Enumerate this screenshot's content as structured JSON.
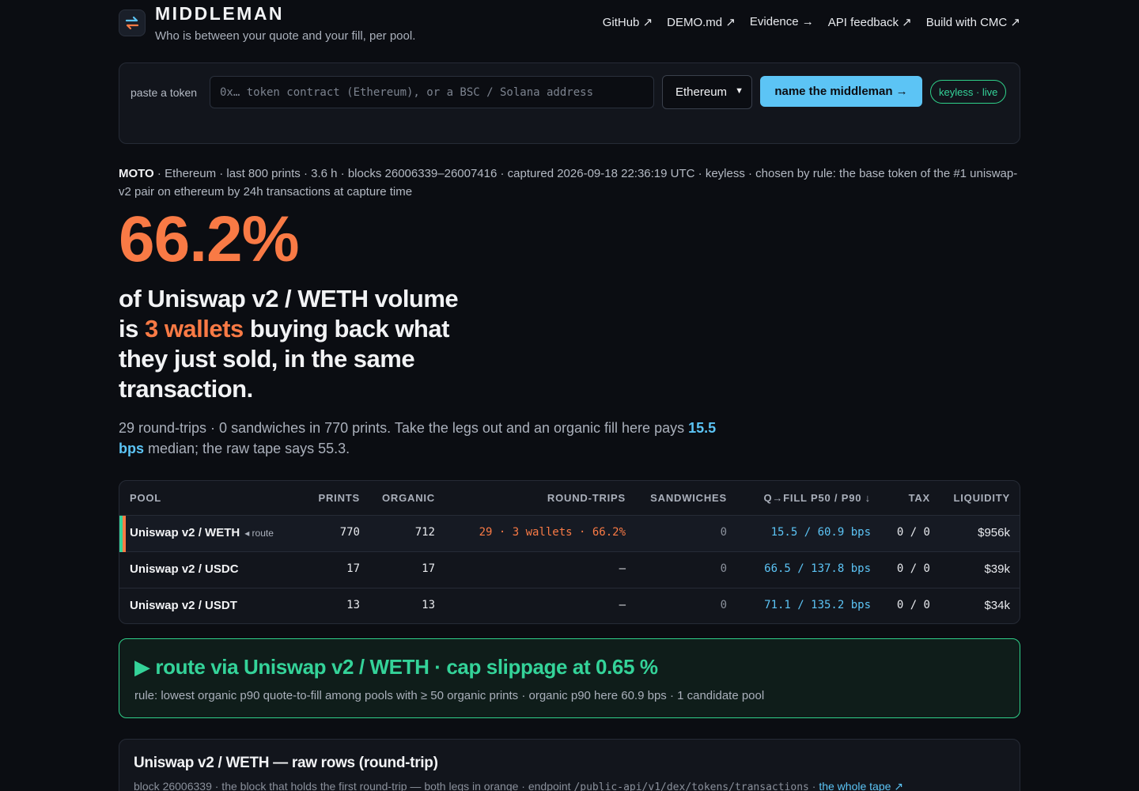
{
  "app": {
    "brand": "MIDDLEMAN",
    "tagline": "Who is between your quote and your fill, per pool."
  },
  "nav": [
    {
      "label": "GitHub ↗"
    },
    {
      "label": "DEMO.md ↗"
    },
    {
      "label": "Evidence →"
    },
    {
      "label": "API feedback ↗"
    },
    {
      "label": "Build with CMC ↗"
    }
  ],
  "search": {
    "label": "paste a token",
    "placeholder": "0x… token contract (Ethereum), or a BSC / Solana address",
    "chain_selected": "Ethereum",
    "submit_label": "name the middleman →",
    "status_badge": "keyless · live"
  },
  "meta": {
    "token": "MOTO",
    "details": " · Ethereum · last 800 prints · 3.6 h · blocks 26006339–26007416 · captured 2026-09-18 22:36:19 UTC · keyless · chosen by rule: the base token of the #1 uniswap-v2 pair on ethereum by 24h transactions at capture time"
  },
  "hero": {
    "percent": "66.2%",
    "line_a": "of Uniswap v2 / WETH volume is ",
    "highlight": "3 wallets",
    "line_b": " buying back what they just sold, in the same transaction."
  },
  "summary": {
    "text_a": "29 round-trips · 0 sandwiches in 770 prints. Take the legs out and an organic fill here pays ",
    "bps": "15.5 bps",
    "text_b": " median; the raw tape says 55.3."
  },
  "table": {
    "headers": {
      "pool": "POOL",
      "prints": "PRINTS",
      "organic": "ORGANIC",
      "round_trips": "ROUND-TRIPS",
      "sandwiches": "SANDWICHES",
      "fill": "Q→FILL P50 / P90 ↓",
      "tax": "TAX",
      "liquidity": "LIQUIDITY"
    },
    "rows": [
      {
        "pool": "Uniswap v2 / WETH",
        "tag": "◂ route",
        "prints": "770",
        "organic": "712",
        "round_trips": "29 · 3 wallets · 66.2%",
        "sandwiches": "0",
        "fill": "15.5 / 60.9 bps",
        "tax": "0 / 0",
        "liquidity": "$956k"
      },
      {
        "pool": "Uniswap v2 / USDC",
        "tag": "",
        "prints": "17",
        "organic": "17",
        "round_trips": "—",
        "sandwiches": "0",
        "fill": "66.5 / 137.8 bps",
        "tax": "0 / 0",
        "liquidity": "$39k"
      },
      {
        "pool": "Uniswap v2 / USDT",
        "tag": "",
        "prints": "13",
        "organic": "13",
        "round_trips": "—",
        "sandwiches": "0",
        "fill": "71.1 / 135.2 bps",
        "tax": "0 / 0",
        "liquidity": "$34k"
      }
    ]
  },
  "route": {
    "title": "▶ route via Uniswap v2 / WETH · cap slippage at 0.65 %",
    "rule": "rule: lowest organic p90 quote-to-fill among pools with ≥ 50 organic prints · organic p90 here 60.9 bps · 1 candidate pool"
  },
  "raw": {
    "title": "Uniswap v2 / WETH — raw rows (round-trip)",
    "sub_a": "block 26006339 · the block that holds the first round-trip — both legs in orange · endpoint ",
    "endpoint": "/public-api/v1/dex/tokens/transactions",
    "sub_b": " · ",
    "link": "the whole tape ↗"
  },
  "colors": {
    "accent_orange": "#f97a45",
    "accent_blue": "#5cc4f5",
    "accent_green": "#34d399",
    "background": "#0b0d12"
  }
}
